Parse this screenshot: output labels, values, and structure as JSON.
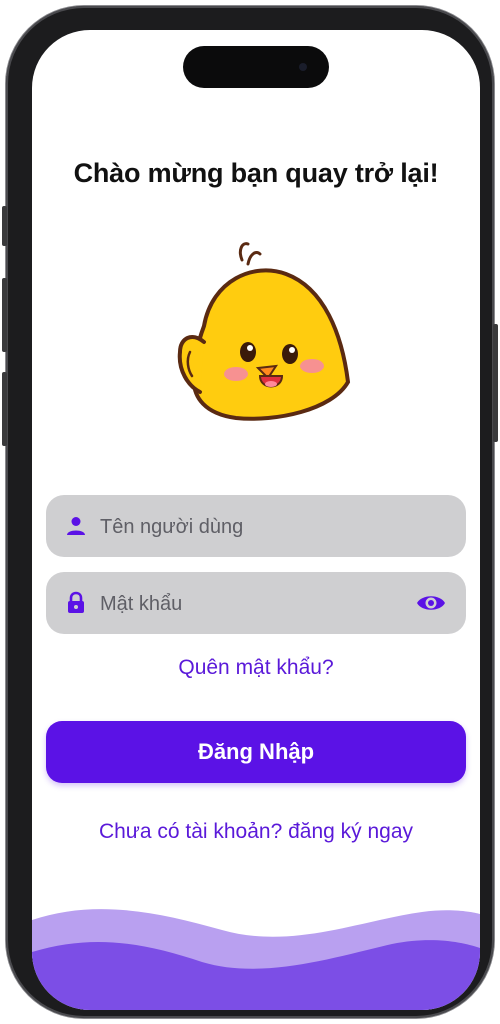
{
  "login": {
    "title": "Chào mừng bạn quay trở lại!",
    "username_placeholder": "Tên người dùng",
    "password_placeholder": "Mật khẩu",
    "forgot_password": "Quên mật khẩu?",
    "login_button": "Đăng Nhập",
    "signup_link": "Chưa có tài khoản? đăng ký ngay"
  },
  "icons": {
    "username": "person-icon",
    "password": "lock-icon",
    "toggle": "eye-icon",
    "mascot": "chick-mascot"
  },
  "colors": {
    "accent": "#5b12e6",
    "link": "#5a19d9",
    "field_bg": "#cfcfd1",
    "wave_light": "#b9a0f0",
    "wave_dark": "#7c4ee6"
  }
}
